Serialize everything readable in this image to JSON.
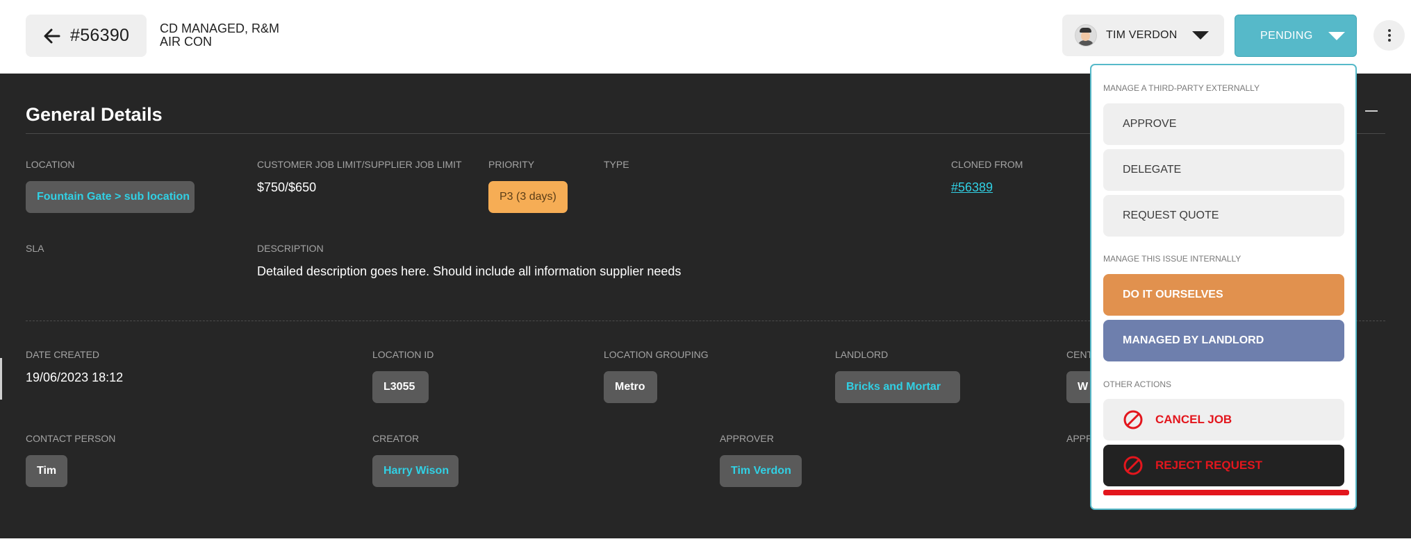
{
  "header": {
    "job_number": "#56390",
    "category_line1": "CD MANAGED, R&M",
    "category_line2": "AIR CON",
    "assignee": "TIM VERDON",
    "status": "PENDING"
  },
  "general": {
    "title": "General Details",
    "location": {
      "label": "LOCATION",
      "value": "Fountain Gate > sub location"
    },
    "job_limit": {
      "label": "CUSTOMER JOB LIMIT/SUPPLIER JOB LIMIT",
      "value": "$750/$650"
    },
    "priority": {
      "label": "PRIORITY",
      "value": "P3 (3 days)"
    },
    "type": {
      "label": "TYPE"
    },
    "cloned_from": {
      "label": "CLONED FROM",
      "value": "#56389"
    },
    "sla": {
      "label": "SLA"
    },
    "description": {
      "label": "DESCRIPTION",
      "value": "Detailed description goes here. Should include all information supplier needs"
    },
    "date_created": {
      "label": "DATE CREATED",
      "value": "19/06/2023 18:12"
    },
    "location_id": {
      "label": "LOCATION ID",
      "value": "L3055"
    },
    "location_grouping": {
      "label": "LOCATION GROUPING",
      "value": "Metro"
    },
    "landlord": {
      "label": "LANDLORD",
      "value": "Bricks and Mortar"
    },
    "centre": {
      "label": "CENT",
      "value": "W"
    },
    "contact_person": {
      "label": "CONTACT PERSON",
      "value": "Tim"
    },
    "creator": {
      "label": "CREATOR",
      "value": "Harry Wison"
    },
    "approver": {
      "label": "APPROVER",
      "value": "Tim Verdon"
    },
    "approval": {
      "label": "APPR"
    }
  },
  "dropdown": {
    "group_external": "MANAGE A THIRD-PARTY EXTERNALLY",
    "approve": "APPROVE",
    "delegate": "DELEGATE",
    "request_quote": "REQUEST QUOTE",
    "group_internal": "MANAGE THIS ISSUE INTERNALLY",
    "do_it_ourselves": "DO IT OURSELVES",
    "managed_by_landlord": "MANAGED BY LANDLORD",
    "group_other": "OTHER ACTIONS",
    "cancel_job": "CANCEL JOB",
    "reject_request": "REJECT REQUEST"
  },
  "colors": {
    "accent": "#56b9c9",
    "link": "#31d0e4",
    "panel": "#262626",
    "priority": "#f6ad55",
    "orange_action": "#e1914e",
    "slate_action": "#6e7fad",
    "danger": "#e3161d"
  },
  "icons": {
    "back": "arrow-left-icon",
    "caret": "caret-down-icon",
    "more": "kebab-menu-icon",
    "collapse": "minus-icon",
    "ban": "ban-icon"
  }
}
